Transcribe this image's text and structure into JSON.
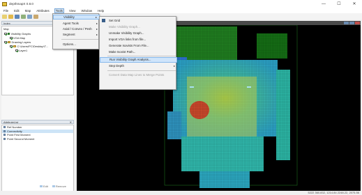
{
  "window": {
    "title": "depthmapX 0.8.0",
    "minimize": "—",
    "maximize": "☐",
    "close": "✕"
  },
  "menubar": [
    "File",
    "Edit",
    "Map",
    "Attributes",
    "Tools",
    "View",
    "Window",
    "Help"
  ],
  "tools_menu": {
    "items": [
      {
        "label": "Visibility",
        "submenu": true
      },
      {
        "label": "Agent Tools",
        "submenu": true
      },
      {
        "label": "Axial / Convex / Pesh",
        "submenu": true
      },
      {
        "label": "Segment",
        "submenu": true
      },
      {
        "label": "Options...",
        "submenu": false
      }
    ]
  },
  "visibility_menu": {
    "items": [
      {
        "label": "Set Grid",
        "enabled": true
      },
      {
        "label": "Make Visibility Graph...",
        "enabled": false
      },
      {
        "label": "Unmake Visibility Graph...",
        "enabled": true
      },
      {
        "label": "Import VGA links from file...",
        "enabled": true
      },
      {
        "label": "Generate Isovists From File...",
        "enabled": true
      },
      {
        "label": "Make Isovist Path...",
        "enabled": true
      },
      {
        "label": "Run Visibility Graph Analysis...",
        "enabled": true
      },
      {
        "label": "Step Depth",
        "enabled": true,
        "submenu": true
      },
      {
        "label": "Convert Data Map Lines to Merge Points",
        "enabled": false
      }
    ]
  },
  "index_pane": {
    "title": "Index",
    "tree": {
      "map_header": "Map",
      "visibility_graphs": "Visibility Graphs",
      "vga_map": "VGA Map",
      "drawing_layers": "Drawing Layers",
      "drawing_file": "C:\\Users\\PC\\Desktop\\T...",
      "layer": "Layer1"
    }
  },
  "attribute_pane": {
    "title": "AttributeList",
    "items": [
      "Ref Number",
      "Connectivity",
      "Point First Moment",
      "Point Second Moment"
    ],
    "selected_index": 1,
    "buttons": [
      "Edit",
      "Remove"
    ]
  },
  "status": {
    "values": "5222    360.832, 1214.84    2248.22, 2075.56"
  },
  "colors": {
    "accent": "#0b6bd3",
    "map_background": "#000000",
    "menu_highlight": "#cfe5fb"
  }
}
